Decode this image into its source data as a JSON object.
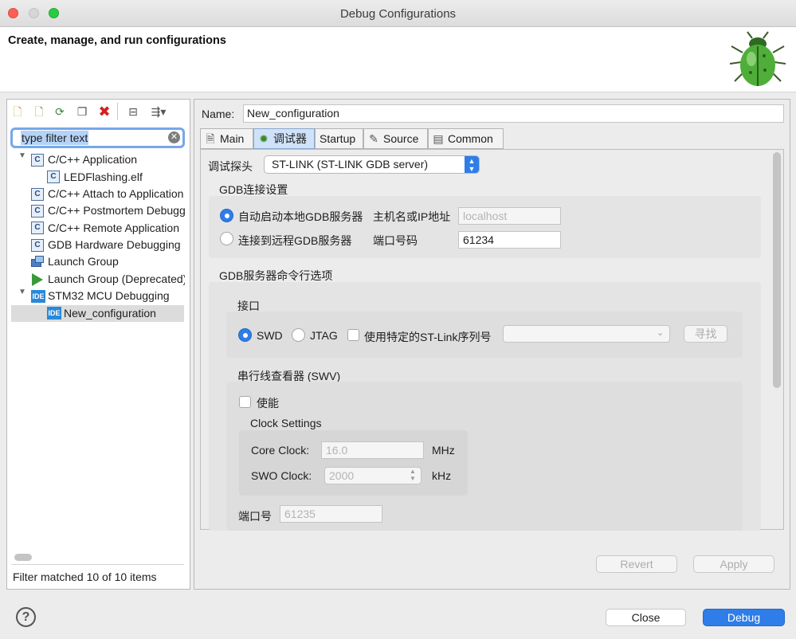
{
  "window": {
    "title": "Debug Configurations"
  },
  "header": {
    "title": "Create, manage, and run configurations"
  },
  "left": {
    "filter": {
      "placeholder": "type filter text",
      "clear_icon": "✕"
    },
    "tree": [
      {
        "label": "C/C++ Application",
        "icon": "c-icon",
        "expanded": true
      },
      {
        "label": "LEDFlashing.elf",
        "icon": "c-icon"
      },
      {
        "label": "C/C++ Attach to Application",
        "icon": "c-icon"
      },
      {
        "label": "C/C++ Postmortem Debugger",
        "icon": "c-icon"
      },
      {
        "label": "C/C++ Remote Application",
        "icon": "c-icon"
      },
      {
        "label": "GDB Hardware Debugging",
        "icon": "c-icon"
      },
      {
        "label": "Launch Group",
        "icon": "launch-group-icon"
      },
      {
        "label": "Launch Group (Deprecated)",
        "icon": "play-icon"
      },
      {
        "label": "STM32 MCU Debugging",
        "icon": "ide-icon",
        "expanded": true
      },
      {
        "label": "New_configuration",
        "icon": "ide-icon",
        "selected": true
      }
    ],
    "status": "Filter matched 10 of 10 items"
  },
  "main": {
    "name_label": "Name:",
    "name_value": "New_configuration",
    "tabs": [
      {
        "label": "Main",
        "icon": "main-tab-icon"
      },
      {
        "label": "调试器",
        "icon": "debugger-bug-icon",
        "active": true
      },
      {
        "label": "Startup",
        "icon": "startup-icon"
      },
      {
        "label": "Source",
        "icon": "source-icon"
      },
      {
        "label": "Common",
        "icon": "common-icon"
      }
    ],
    "probe_label": "调试探头",
    "probe_value": "ST-LINK (ST-LINK GDB server)",
    "gdb_conn": {
      "title": "GDB连接设置",
      "auto_start": "自动启动本地GDB服务器",
      "connect_remote": "连接到远程GDB服务器",
      "host_label": "主机名或IP地址",
      "host_value": "localhost",
      "port_label": "端口号码",
      "port_value": "61234"
    },
    "gdb_cmd": {
      "title": "GDB服务器命令行选项",
      "interface": {
        "title": "接口",
        "swd": "SWD",
        "jtag": "JTAG",
        "use_serial": "使用特定的ST-Link序列号",
        "serial_value": "",
        "find": "寻找"
      },
      "swv": {
        "title": "串行线查看器 (SWV)",
        "enable": "使能",
        "clock": {
          "title": "Clock Settings",
          "core_label": "Core Clock:",
          "core_value": "16.0",
          "core_unit": "MHz",
          "swo_label": "SWO Clock:",
          "swo_value": "2000",
          "swo_unit": "kHz"
        },
        "port_label": "端口号",
        "port_value": "61235"
      }
    },
    "revert": "Revert",
    "apply": "Apply"
  },
  "footer": {
    "help_icon": "?",
    "close": "Close",
    "debug": "Debug"
  }
}
